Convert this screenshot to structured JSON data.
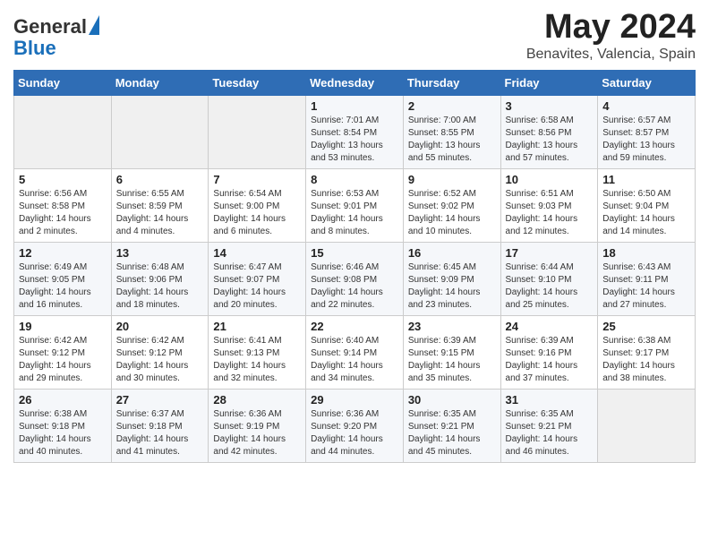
{
  "header": {
    "logo_general": "General",
    "logo_blue": "Blue",
    "month_title": "May 2024",
    "location": "Benavites, Valencia, Spain"
  },
  "days_of_week": [
    "Sunday",
    "Monday",
    "Tuesday",
    "Wednesday",
    "Thursday",
    "Friday",
    "Saturday"
  ],
  "weeks": [
    [
      {
        "day": "",
        "info": ""
      },
      {
        "day": "",
        "info": ""
      },
      {
        "day": "",
        "info": ""
      },
      {
        "day": "1",
        "info": "Sunrise: 7:01 AM\nSunset: 8:54 PM\nDaylight: 13 hours\nand 53 minutes."
      },
      {
        "day": "2",
        "info": "Sunrise: 7:00 AM\nSunset: 8:55 PM\nDaylight: 13 hours\nand 55 minutes."
      },
      {
        "day": "3",
        "info": "Sunrise: 6:58 AM\nSunset: 8:56 PM\nDaylight: 13 hours\nand 57 minutes."
      },
      {
        "day": "4",
        "info": "Sunrise: 6:57 AM\nSunset: 8:57 PM\nDaylight: 13 hours\nand 59 minutes."
      }
    ],
    [
      {
        "day": "5",
        "info": "Sunrise: 6:56 AM\nSunset: 8:58 PM\nDaylight: 14 hours\nand 2 minutes."
      },
      {
        "day": "6",
        "info": "Sunrise: 6:55 AM\nSunset: 8:59 PM\nDaylight: 14 hours\nand 4 minutes."
      },
      {
        "day": "7",
        "info": "Sunrise: 6:54 AM\nSunset: 9:00 PM\nDaylight: 14 hours\nand 6 minutes."
      },
      {
        "day": "8",
        "info": "Sunrise: 6:53 AM\nSunset: 9:01 PM\nDaylight: 14 hours\nand 8 minutes."
      },
      {
        "day": "9",
        "info": "Sunrise: 6:52 AM\nSunset: 9:02 PM\nDaylight: 14 hours\nand 10 minutes."
      },
      {
        "day": "10",
        "info": "Sunrise: 6:51 AM\nSunset: 9:03 PM\nDaylight: 14 hours\nand 12 minutes."
      },
      {
        "day": "11",
        "info": "Sunrise: 6:50 AM\nSunset: 9:04 PM\nDaylight: 14 hours\nand 14 minutes."
      }
    ],
    [
      {
        "day": "12",
        "info": "Sunrise: 6:49 AM\nSunset: 9:05 PM\nDaylight: 14 hours\nand 16 minutes."
      },
      {
        "day": "13",
        "info": "Sunrise: 6:48 AM\nSunset: 9:06 PM\nDaylight: 14 hours\nand 18 minutes."
      },
      {
        "day": "14",
        "info": "Sunrise: 6:47 AM\nSunset: 9:07 PM\nDaylight: 14 hours\nand 20 minutes."
      },
      {
        "day": "15",
        "info": "Sunrise: 6:46 AM\nSunset: 9:08 PM\nDaylight: 14 hours\nand 22 minutes."
      },
      {
        "day": "16",
        "info": "Sunrise: 6:45 AM\nSunset: 9:09 PM\nDaylight: 14 hours\nand 23 minutes."
      },
      {
        "day": "17",
        "info": "Sunrise: 6:44 AM\nSunset: 9:10 PM\nDaylight: 14 hours\nand 25 minutes."
      },
      {
        "day": "18",
        "info": "Sunrise: 6:43 AM\nSunset: 9:11 PM\nDaylight: 14 hours\nand 27 minutes."
      }
    ],
    [
      {
        "day": "19",
        "info": "Sunrise: 6:42 AM\nSunset: 9:12 PM\nDaylight: 14 hours\nand 29 minutes."
      },
      {
        "day": "20",
        "info": "Sunrise: 6:42 AM\nSunset: 9:12 PM\nDaylight: 14 hours\nand 30 minutes."
      },
      {
        "day": "21",
        "info": "Sunrise: 6:41 AM\nSunset: 9:13 PM\nDaylight: 14 hours\nand 32 minutes."
      },
      {
        "day": "22",
        "info": "Sunrise: 6:40 AM\nSunset: 9:14 PM\nDaylight: 14 hours\nand 34 minutes."
      },
      {
        "day": "23",
        "info": "Sunrise: 6:39 AM\nSunset: 9:15 PM\nDaylight: 14 hours\nand 35 minutes."
      },
      {
        "day": "24",
        "info": "Sunrise: 6:39 AM\nSunset: 9:16 PM\nDaylight: 14 hours\nand 37 minutes."
      },
      {
        "day": "25",
        "info": "Sunrise: 6:38 AM\nSunset: 9:17 PM\nDaylight: 14 hours\nand 38 minutes."
      }
    ],
    [
      {
        "day": "26",
        "info": "Sunrise: 6:38 AM\nSunset: 9:18 PM\nDaylight: 14 hours\nand 40 minutes."
      },
      {
        "day": "27",
        "info": "Sunrise: 6:37 AM\nSunset: 9:18 PM\nDaylight: 14 hours\nand 41 minutes."
      },
      {
        "day": "28",
        "info": "Sunrise: 6:36 AM\nSunset: 9:19 PM\nDaylight: 14 hours\nand 42 minutes."
      },
      {
        "day": "29",
        "info": "Sunrise: 6:36 AM\nSunset: 9:20 PM\nDaylight: 14 hours\nand 44 minutes."
      },
      {
        "day": "30",
        "info": "Sunrise: 6:35 AM\nSunset: 9:21 PM\nDaylight: 14 hours\nand 45 minutes."
      },
      {
        "day": "31",
        "info": "Sunrise: 6:35 AM\nSunset: 9:21 PM\nDaylight: 14 hours\nand 46 minutes."
      },
      {
        "day": "",
        "info": ""
      }
    ]
  ]
}
